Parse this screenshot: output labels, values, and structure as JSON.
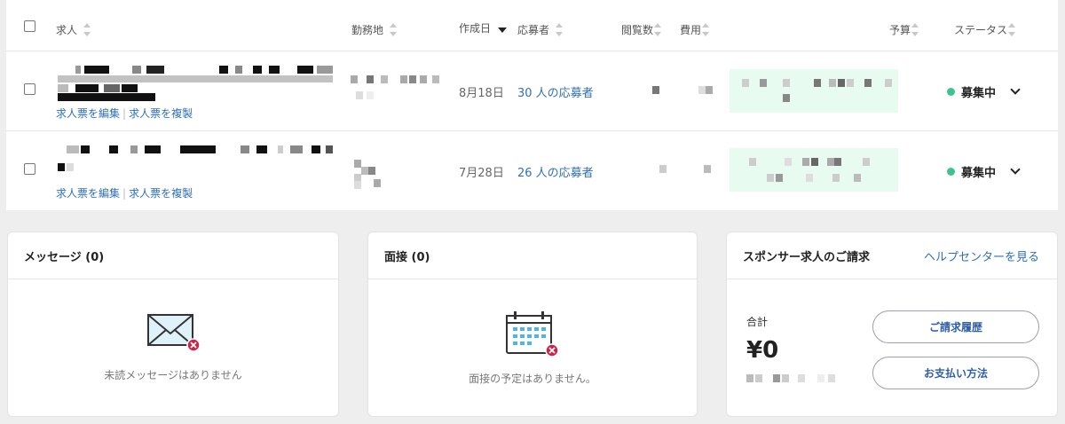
{
  "table": {
    "columns": {
      "job": "求人",
      "location": "勤務地",
      "created": "作成日",
      "applicants": "応募者",
      "views": "閲覧数",
      "cost": "費用",
      "budget": "予算",
      "status": "ステータス"
    },
    "rows": [
      {
        "created": "8月18日",
        "applicants": "30 人の応募者",
        "edit_link": "求人票を編集",
        "separator": "|",
        "copy_link": "求人票を複製",
        "status": "募集中"
      },
      {
        "created": "7月28日",
        "applicants": "26 人の応募者",
        "edit_link": "求人票を編集",
        "separator": "|",
        "copy_link": "求人票を複製",
        "status": "募集中"
      }
    ]
  },
  "messages": {
    "title": "メッセージ (0)",
    "empty": "未読メッセージはありません"
  },
  "interviews": {
    "title": "面接 (0)",
    "empty": "面接の予定はありません。"
  },
  "billing": {
    "title": "スポンサー求人のご請求",
    "help_link": "ヘルプセンターを見る",
    "total_label": "合計",
    "total_value": "¥0",
    "history_button": "ご請求履歴",
    "payment_button": "お支払い方法"
  },
  "colors": {
    "accent": "#2f6fba",
    "status_active": "#3ec48a",
    "pixelated_highlight": "#e7fbf1"
  }
}
